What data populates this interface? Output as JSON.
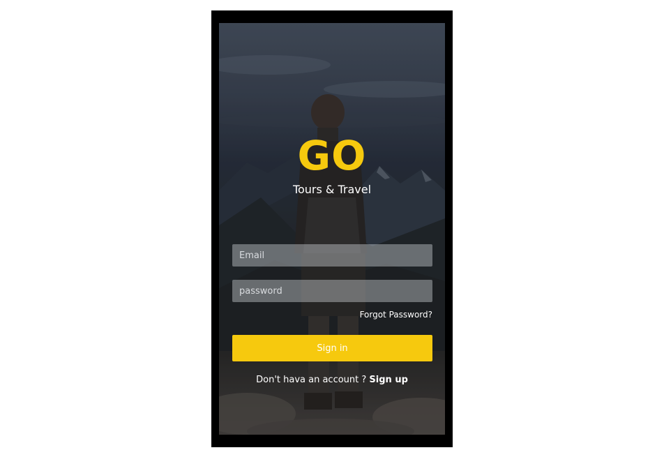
{
  "brand": {
    "logo": "GO",
    "tagline": "Tours & Travel",
    "accent_color": "#f6c90e"
  },
  "form": {
    "email_placeholder": "Email",
    "password_placeholder": "password",
    "forgot_label": "Forgot Password?",
    "signin_label": "Sign in"
  },
  "footer": {
    "prompt": "Don't hava an account ?",
    "signup_label": "Sign up"
  }
}
